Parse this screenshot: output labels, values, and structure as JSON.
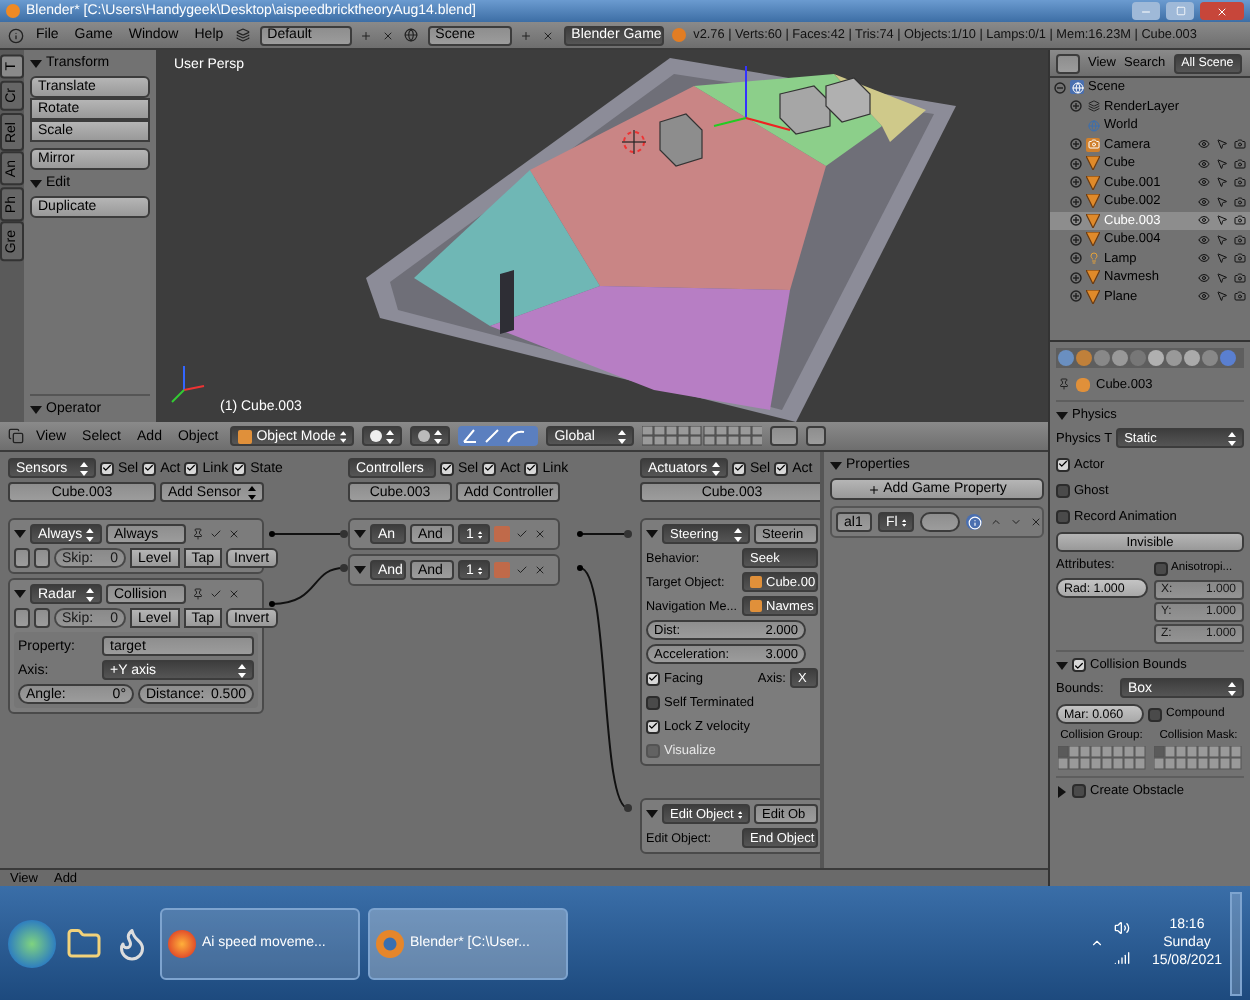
{
  "title_bar": {
    "title": "Blender* [C:\\Users\\Handygeek\\Desktop\\aispeedbricktheoryAug14.blend]"
  },
  "info_header": {
    "menus": [
      "File",
      "Game",
      "Window",
      "Help"
    ],
    "screen_layout": "Default",
    "scene": "Scene",
    "render_engine": "Blender Game",
    "stats": "v2.76 | Verts:60 | Faces:42 | Tris:74 | Objects:1/10 | Lamps:0/1 | Mem:16.23M | Cube.003"
  },
  "tool_shelf": {
    "tabs": [
      {
        "label": "T",
        "selected": true
      },
      {
        "label": "Cr",
        "selected": false
      },
      {
        "label": "Rel",
        "selected": false
      },
      {
        "label": "An",
        "selected": false
      },
      {
        "label": "Ph",
        "selected": false
      },
      {
        "label": "Gre",
        "selected": false
      }
    ],
    "panels": [
      {
        "title": "Transform",
        "expanded": true,
        "button_groups": [
          [
            "Translate",
            "Rotate",
            "Scale"
          ],
          [
            "Mirror"
          ]
        ]
      },
      {
        "title": "Edit",
        "expanded": true,
        "button_groups": [
          [
            "Duplicate"
          ]
        ]
      }
    ],
    "operator_panel": {
      "title": "Operator",
      "expanded": true
    }
  },
  "viewport": {
    "view_name": "User Persp",
    "active_object": "(1) Cube.003"
  },
  "view3d_header": {
    "menus": [
      "View",
      "Select",
      "Add",
      "Object"
    ],
    "mode": "Object Mode",
    "orientation": "Global"
  },
  "logic_editor": {
    "sensors": {
      "menu": "Sensors",
      "filters": [
        {
          "label": "Sel",
          "checked": true
        },
        {
          "label": "Act",
          "checked": true
        },
        {
          "label": "Link",
          "checked": true
        },
        {
          "label": "State",
          "checked": true
        }
      ],
      "object": "Cube.003",
      "add_button": "Add Sensor",
      "items": [
        {
          "type": "Always",
          "name": "Always",
          "expanded": true,
          "skip_label": "Skip:",
          "skip": "0",
          "level_button": "Level",
          "tap_button": "Tap",
          "invert_button": "Invert"
        },
        {
          "type": "Radar",
          "name": "Collision",
          "expanded": true,
          "skip_label": "Skip:",
          "skip": "0",
          "level_button": "Level",
          "tap_button": "Tap",
          "invert_button": "Invert",
          "settings": {
            "property_label": "Property:",
            "property": "target",
            "axis_label": "Axis:",
            "axis": "+Y axis",
            "angle_label": "Angle:",
            "angle": "0°",
            "distance_label": "Distance:",
            "distance": "0.500"
          }
        }
      ]
    },
    "controllers": {
      "menu": "Controllers",
      "filters": [
        {
          "label": "Sel",
          "checked": true
        },
        {
          "label": "Act",
          "checked": true
        },
        {
          "label": "Link",
          "checked": true
        }
      ],
      "object": "Cube.003",
      "add_button": "Add Controller",
      "items": [
        {
          "type": "An",
          "name": "And",
          "state": "1",
          "expanded": true
        },
        {
          "type": "And",
          "name": "And",
          "state": "1",
          "expanded": true
        }
      ]
    },
    "actuators": {
      "menu": "Actuators",
      "filters": [
        {
          "label": "Sel",
          "checked": true
        },
        {
          "label": "Act",
          "checked": true
        }
      ],
      "object": "Cube.003",
      "items": [
        {
          "type": "Steering",
          "name": "Steerin",
          "expanded": true,
          "rows": [
            {
              "kind": "dropdown",
              "label": "Behavior:",
              "value": "Seek"
            },
            {
              "kind": "object",
              "label": "Target Object:",
              "value": "Cube.00"
            },
            {
              "kind": "object",
              "label": "Navigation Me...",
              "value": "Navmes"
            },
            {
              "kind": "number",
              "label": "Dist:",
              "value": "2.000"
            },
            {
              "kind": "number",
              "label": "Acceleration:",
              "value": "3.000"
            },
            {
              "kind": "check",
              "label": "Facing",
              "checked": true,
              "disabled": false,
              "extra_label": "Axis:",
              "extra_value": "X"
            },
            {
              "kind": "check",
              "label": "Self Terminated",
              "checked": false,
              "disabled": false
            },
            {
              "kind": "check",
              "label": "Lock Z velocity",
              "checked": true,
              "disabled": false
            },
            {
              "kind": "check",
              "label": "Visualize",
              "checked": false,
              "disabled": true
            }
          ]
        },
        {
          "type": "Edit Object",
          "name": "Edit Ob",
          "expanded": true,
          "rows": [
            {
              "kind": "dropdown",
              "label": "Edit Object:",
              "value": "End Object"
            }
          ]
        }
      ]
    }
  },
  "game_properties": {
    "title": "Properties",
    "expanded": true,
    "add_button": "Add Game Property",
    "items": [
      {
        "name": "al1",
        "type": "Fl"
      }
    ]
  },
  "logic_footer": {
    "menus": [
      "View",
      "Add"
    ]
  },
  "outliner": {
    "menus": [
      "View",
      "Search"
    ],
    "display_mode": "All Scene",
    "tree": [
      {
        "name": "Scene",
        "kind": "scene",
        "expanded": true,
        "selected": false,
        "children": [
          {
            "name": "RenderLayer",
            "kind": "renderlayer",
            "expanded": false,
            "selected": false
          },
          {
            "name": "World",
            "kind": "world",
            "selected": false
          },
          {
            "name": "Camera",
            "kind": "camera",
            "expanded": false,
            "selected": false
          },
          {
            "name": "Cube",
            "kind": "mesh",
            "expanded": false,
            "selected": false
          },
          {
            "name": "Cube.001",
            "kind": "mesh",
            "expanded": false,
            "selected": false
          },
          {
            "name": "Cube.002",
            "kind": "mesh",
            "expanded": false,
            "selected": false
          },
          {
            "name": "Cube.003",
            "kind": "mesh",
            "expanded": false,
            "selected": true
          },
          {
            "name": "Cube.004",
            "kind": "mesh",
            "expanded": false,
            "selected": false
          },
          {
            "name": "Lamp",
            "kind": "lamp",
            "expanded": false,
            "selected": false
          },
          {
            "name": "Navmesh",
            "kind": "mesh",
            "expanded": false,
            "selected": false
          },
          {
            "name": "Plane",
            "kind": "mesh",
            "expanded": false,
            "selected": false
          }
        ]
      }
    ]
  },
  "properties_editor": {
    "object": "Cube.003",
    "physics": {
      "title": "Physics",
      "expanded": true,
      "type_label": "Physics T",
      "type": "Static",
      "options": [
        {
          "label": "Actor",
          "checked": true
        },
        {
          "label": "Ghost",
          "checked": false
        },
        {
          "label": "Record Animation",
          "checked": false
        }
      ],
      "invisible_button": "Invisible",
      "attributes_label": "Attributes:",
      "radius": "Rad: 1.000",
      "anisotropic": {
        "label": "Anisotropi...",
        "checked": false
      },
      "friction": [
        {
          "axis": "X:",
          "value": "1.000"
        },
        {
          "axis": "Y:",
          "value": "1.000"
        },
        {
          "axis": "Z:",
          "value": "1.000"
        }
      ]
    },
    "collision_bounds": {
      "title": "Collision Bounds",
      "enabled": true,
      "expanded": true,
      "bounds_label": "Bounds:",
      "bounds": "Box",
      "margin": "Mar: 0.060",
      "compound": {
        "label": "Compound",
        "checked": false
      },
      "group_label": "Collision Group:",
      "mask_label": "Collision Mask:"
    },
    "create_obstacle": {
      "title": "Create Obstacle",
      "enabled": false,
      "expanded": false
    }
  },
  "taskbar": {
    "tasks": [
      {
        "label": "Ai speed moveme...",
        "kind": "browser"
      },
      {
        "label": "Blender* [C:\\User...",
        "kind": "blender"
      }
    ],
    "time": "18:16",
    "day": "Sunday",
    "date": "15/08/2021"
  }
}
